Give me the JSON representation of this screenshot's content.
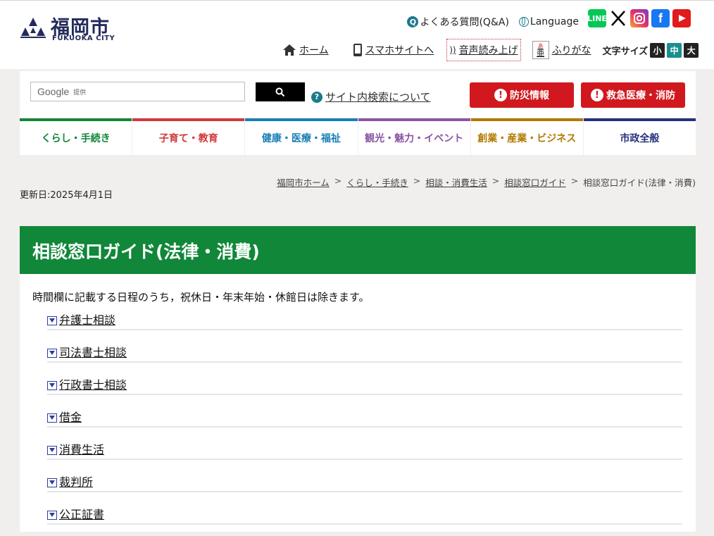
{
  "header": {
    "logo_title": "福岡市",
    "logo_sub": "FUKUOKA CITY",
    "faq_label": "よくある質問(Q&A)",
    "language_label": "Language",
    "sns": [
      "LINE",
      "X",
      "Instagram",
      "Facebook",
      "YouTube"
    ],
    "home_label": "ホーム",
    "mobile_label": "スマホサイトへ",
    "reader_label": "音声読み上げ",
    "furigana_label": "ふりがな",
    "fontsize_label": "文字サイズ",
    "fontsize_small": "小",
    "fontsize_medium": "中",
    "fontsize_large": "大"
  },
  "search": {
    "google_label": "Google",
    "provided_label": "提供",
    "help_label": "サイト内検索について",
    "disaster_label": "防災情報",
    "emergency_label": "救急医療・消防"
  },
  "categories": [
    {
      "label": "くらし・手続き",
      "color": "#118739"
    },
    {
      "label": "子育て・教育",
      "color": "#d1393d"
    },
    {
      "label": "健康・医療・福祉",
      "color": "#1a7fb5"
    },
    {
      "label": "観光・魅力・イベント",
      "color": "#8a55a3"
    },
    {
      "label": "創業・産業・ビジネス",
      "color": "#b17a00"
    },
    {
      "label": "市政全般",
      "color": "#25317d"
    }
  ],
  "breadcrumb": {
    "items": [
      "福岡市ホーム",
      "くらし・手続き",
      "相談・消費生活",
      "相談窓口ガイド"
    ],
    "current": "相談窓口ガイド(法律・消費)",
    "separator": ">"
  },
  "updated": "更新日:2025年4月1日",
  "page": {
    "title": "相談窓口ガイド(法律・消費)",
    "intro": "時間欄に記載する日程のうち，祝休日・年末年始・休館日は除きます。",
    "sections": [
      "弁護士相談",
      "司法書士相談",
      "行政書士相談",
      "借金",
      "消費生活",
      "裁判所",
      "公正証書"
    ]
  }
}
